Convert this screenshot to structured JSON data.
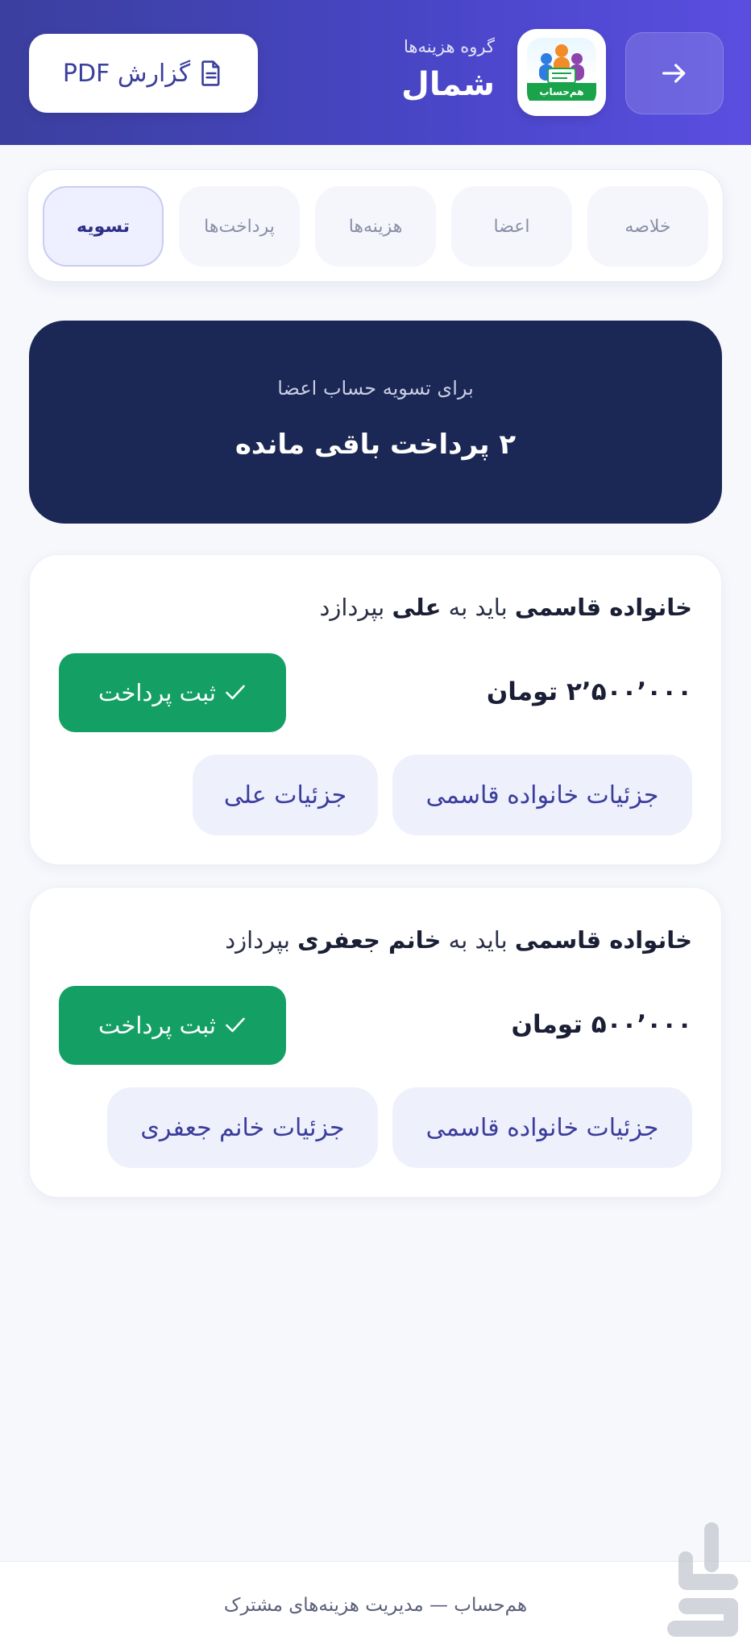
{
  "header": {
    "group_subtitle": "گروه هزینه‌ها",
    "group_name": "شمال",
    "pdf_label": "گزارش PDF",
    "logo_text": "هم‌حساب"
  },
  "tabs": [
    {
      "label": "خلاصه",
      "active": false
    },
    {
      "label": "اعضا",
      "active": false
    },
    {
      "label": "هزینه‌ها",
      "active": false
    },
    {
      "label": "پرداخت‌ها",
      "active": false
    },
    {
      "label": "تسویه",
      "active": true
    }
  ],
  "summary": {
    "subtitle": "برای تسویه حساب اعضا",
    "main": "۲ پرداخت باقی مانده"
  },
  "settlements": [
    {
      "payer": "خانواده قاسمی",
      "connector": "باید به",
      "payee": "علی",
      "verb": "بپردازد",
      "amount": "۲٬۵۰۰٬۰۰۰ تومان",
      "pay_label": "ثبت پرداخت",
      "detail_payer": "جزئیات خانواده قاسمی",
      "detail_payee": "جزئیات علی"
    },
    {
      "payer": "خانواده قاسمی",
      "connector": "باید به",
      "payee": "خانم جعفری",
      "verb": "بپردازد",
      "amount": "۵۰۰٬۰۰۰ تومان",
      "pay_label": "ثبت پرداخت",
      "detail_payer": "جزئیات خانواده قاسمی",
      "detail_payee": "جزئیات خانم جعفری"
    }
  ],
  "footer": {
    "text": "هم‌حساب — مدیریت هزینه‌های مشترک"
  },
  "colors": {
    "header_start": "#3b3f9e",
    "header_end": "#5a4ee0",
    "summary_bg": "#1b2754",
    "pay_green": "#14a064",
    "detail_bg": "#eef0fc"
  },
  "icons": [
    "arrow-right-icon",
    "document-icon",
    "check-icon",
    "app-logo"
  ]
}
